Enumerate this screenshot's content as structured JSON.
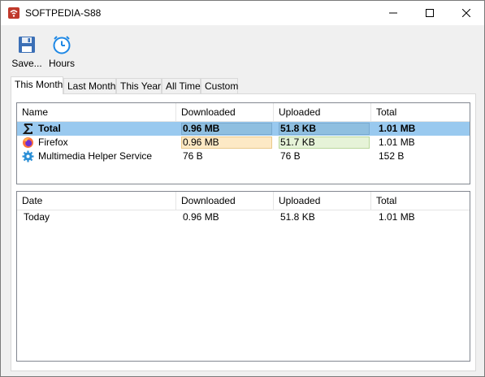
{
  "window": {
    "title": "SOFTPEDIA-S88"
  },
  "toolbar": {
    "save_label": "Save...",
    "hours_label": "Hours"
  },
  "tabs": [
    {
      "label": "This Month",
      "active": true
    },
    {
      "label": "Last Month",
      "active": false
    },
    {
      "label": "This Year",
      "active": false
    },
    {
      "label": "All Time",
      "active": false
    },
    {
      "label": "Custom",
      "active": false
    }
  ],
  "apps_table": {
    "columns": [
      "Name",
      "Downloaded",
      "Uploaded",
      "Total"
    ],
    "rows": [
      {
        "icon": "sigma-icon",
        "name": "Total",
        "downloaded": "0.96 MB",
        "uploaded": "51.8 KB",
        "total": "1.01 MB",
        "selected": true
      },
      {
        "icon": "firefox-icon",
        "name": "Firefox",
        "downloaded": "0.96 MB",
        "uploaded": "51.7 KB",
        "total": "1.01 MB",
        "selected": false
      },
      {
        "icon": "gear-icon",
        "name": "Multimedia Helper Service",
        "downloaded": "76 B",
        "uploaded": "76 B",
        "total": "152 B",
        "selected": false
      }
    ]
  },
  "dates_table": {
    "columns": [
      "Date",
      "Downloaded",
      "Uploaded",
      "Total"
    ],
    "rows": [
      {
        "date": "Today",
        "downloaded": "0.96 MB",
        "uploaded": "51.8 KB",
        "total": "1.01 MB"
      }
    ]
  },
  "colors": {
    "selection": "#99c9ef",
    "download_bar": "#fde9c5",
    "upload_bar": "#e6f3d8"
  }
}
